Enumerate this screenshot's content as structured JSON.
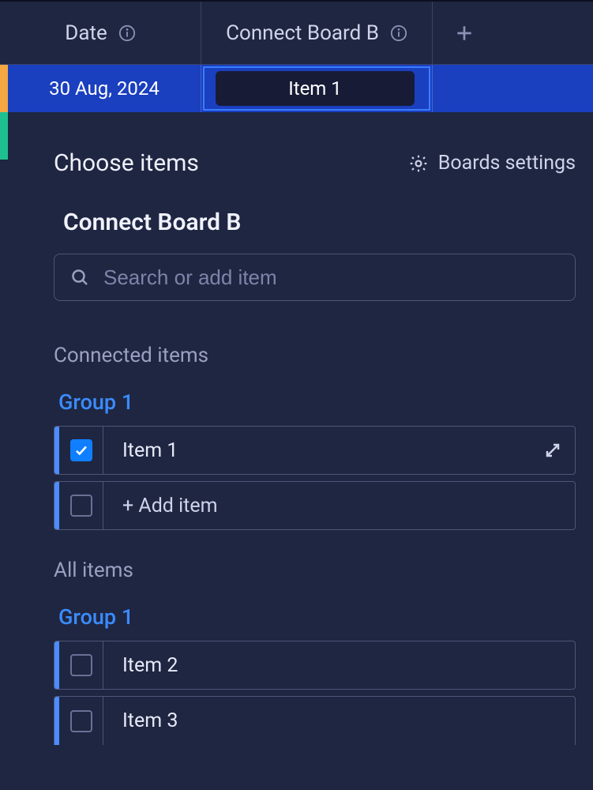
{
  "header": {
    "date_col": "Date",
    "connect_col": "Connect Board B"
  },
  "row1": {
    "date": "30 Aug, 2024",
    "connect_chip": "Item 1"
  },
  "popup": {
    "title": "Choose items",
    "settings": "Boards settings",
    "board_name": "Connect Board B",
    "search_placeholder": "Search or add item",
    "connected_label": "Connected items",
    "all_label": "All items",
    "group1_name": "Group 1",
    "item1": "Item 1",
    "add_item": "+ Add item",
    "item2": "Item 2",
    "item3": "Item 3"
  }
}
